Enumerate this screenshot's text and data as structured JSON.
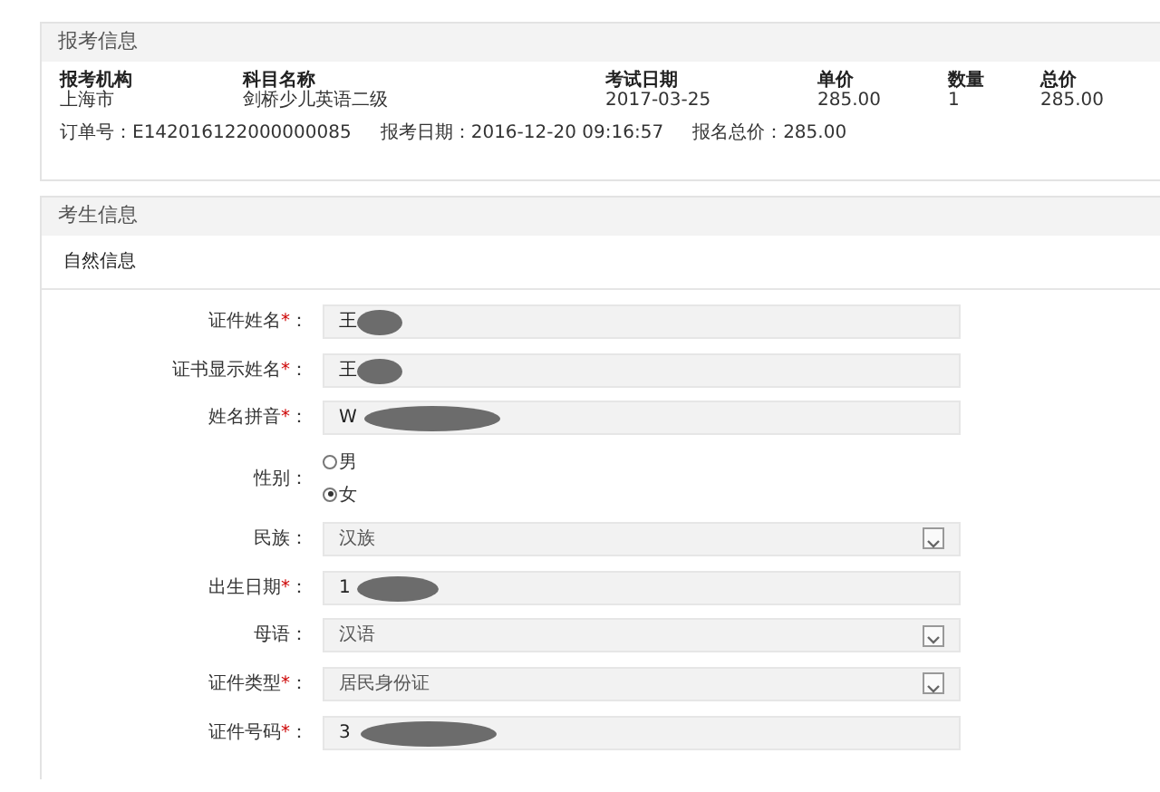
{
  "order_panel": {
    "title": "报考信息",
    "columns": [
      "报考机构",
      "科目名称",
      "考试日期",
      "单价",
      "数量",
      "总价"
    ],
    "row": [
      "上海市",
      "剑桥少儿英语二级",
      "2017-03-25",
      "285.00",
      "1",
      "285.00"
    ],
    "summary": [
      "订单号：E142016122000000085",
      "报考日期：2016-12-20 09:16:57",
      "报名总价：285.00"
    ]
  },
  "candidate_panel": {
    "title": "考生信息",
    "section": "自然信息",
    "fields": [
      {
        "kind": "text",
        "label": "证件姓名",
        "required_mark": "*",
        "suffix": "：",
        "value": "王",
        "redacted": true
      },
      {
        "kind": "text",
        "label": "证书显示姓名",
        "required_mark": "*",
        "suffix": "：",
        "value": "王",
        "redacted": true
      },
      {
        "kind": "text",
        "label": "姓名拼音",
        "required_mark": "*",
        "suffix": "：",
        "value": "W",
        "redacted": true
      },
      {
        "kind": "radio",
        "label": "性别",
        "suffix": "：",
        "options": [
          {
            "label": "男",
            "selected": false
          },
          {
            "label": "女",
            "selected": true
          }
        ]
      },
      {
        "kind": "select",
        "label": "民族",
        "suffix": "：",
        "value": "汉族"
      },
      {
        "kind": "text",
        "label": "出生日期",
        "required_mark": "*",
        "suffix": "：",
        "value": "1",
        "redacted": true
      },
      {
        "kind": "select",
        "label": "母语",
        "suffix": "：",
        "value": "汉语"
      },
      {
        "kind": "select",
        "label": "证件类型",
        "required_mark": "*",
        "suffix": "：",
        "value": "居民身份证"
      },
      {
        "kind": "text",
        "label": "证件号码",
        "required_mark": "*",
        "suffix": "：",
        "value": "3",
        "redacted": true
      }
    ]
  }
}
